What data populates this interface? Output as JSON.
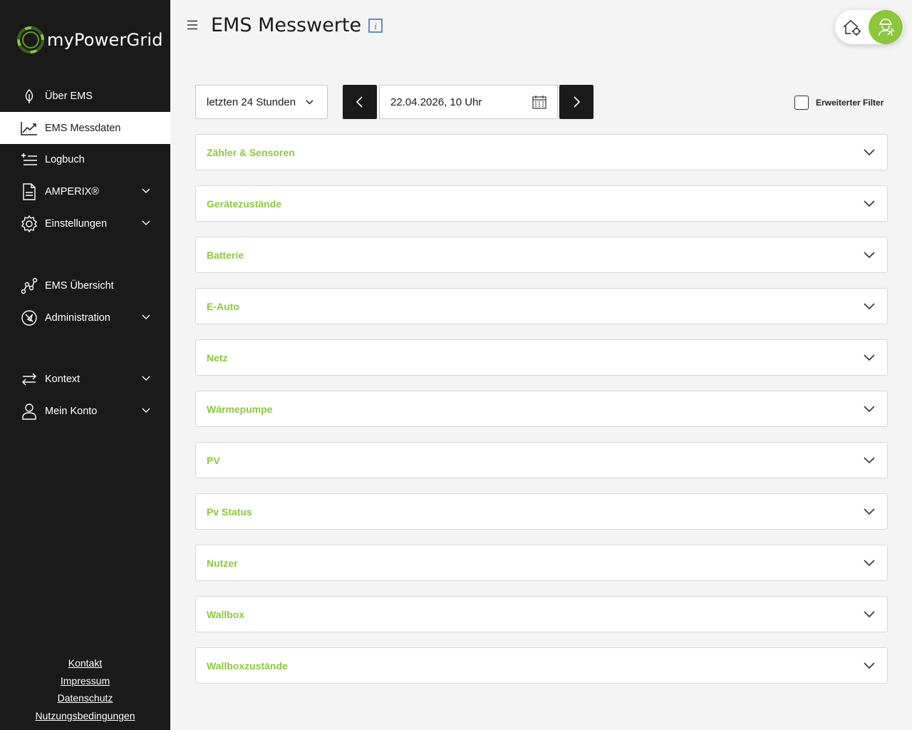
{
  "app": {
    "name": "myPowerGrid",
    "brand_color": "#8cc63f",
    "sidebar_color": "#1a1a1a"
  },
  "sidebar": {
    "items": [
      {
        "label": "Über EMS",
        "icon": "leaf-icon"
      },
      {
        "label": "EMS Messdaten",
        "icon": "line-chart-icon",
        "active": true
      },
      {
        "label": "Logbuch",
        "icon": "list-add-icon"
      },
      {
        "label": "AMPERIX®",
        "icon": "document-icon",
        "expandable": true
      },
      {
        "label": "Einstellungen",
        "icon": "gear-icon",
        "expandable": true
      },
      {
        "label": "EMS Übersicht",
        "icon": "network-graph-icon"
      },
      {
        "label": "Administration",
        "icon": "compass-icon",
        "expandable": true
      },
      {
        "label": "Kontext",
        "icon": "swap-arrows-icon",
        "expandable": true
      },
      {
        "label": "Mein Konto",
        "icon": "user-icon",
        "expandable": true
      }
    ],
    "footer": [
      "Kontakt",
      "Impressum",
      "Datenschutz",
      "Nutzungsbedingungen"
    ]
  },
  "header": {
    "title": "EMS Messwerte"
  },
  "toolbar": {
    "range": "letzten 24 Stunden",
    "date": "22.04.2026, 10 Uhr",
    "filter_label": "Erweiterter Filter",
    "filter_checked": false
  },
  "sections": [
    "Zähler & Sensoren",
    "Gerätezustände",
    "Batterie",
    "E-Auto",
    "Netz",
    "Wärmepumpe",
    "PV",
    "Pv Status",
    "Nutzer",
    "Wallbox",
    "Wallboxzustände"
  ]
}
